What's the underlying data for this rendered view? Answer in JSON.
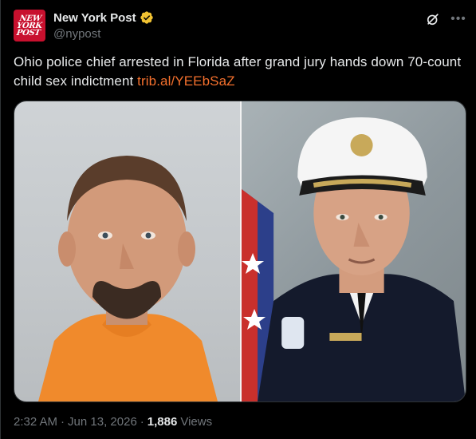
{
  "author": {
    "display_name": "New York Post",
    "handle": "@nypost",
    "avatar_logo_text": "NEW YORK POST",
    "verified_color": "#f1c232"
  },
  "header_actions": {
    "grok_icon": "grok-icon",
    "more_icon": "more-options-icon"
  },
  "post": {
    "text": "Ohio police chief arrested in Florida after grand jury hands down 70-count child sex indictment ",
    "link": "trib.al/YEEbSaZ",
    "link_color": "#f4702d"
  },
  "media": {
    "left_photo": "mugshot of man in orange jumpsuit",
    "right_photo": "official portrait of police chief in uniform"
  },
  "meta": {
    "time": "2:32 AM",
    "sep1": "·",
    "date": "Jun 13, 2026",
    "sep2": "·",
    "views_count": "1,886",
    "views_label": "Views"
  }
}
